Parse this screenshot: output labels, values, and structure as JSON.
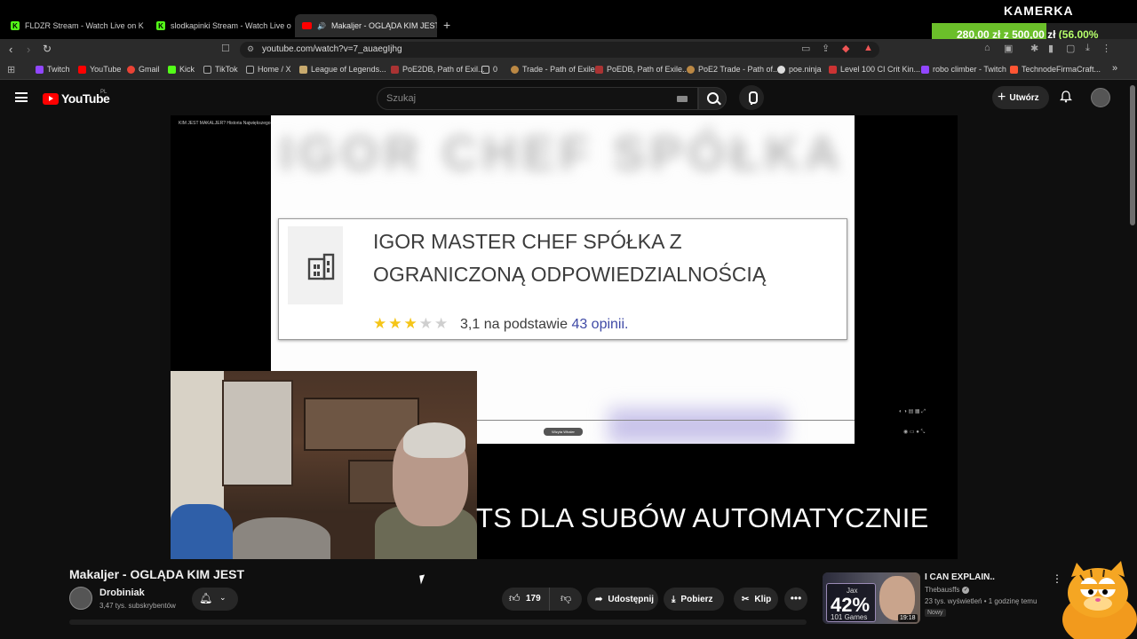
{
  "browser": {
    "tabs": [
      {
        "label": "FLDZR Stream - Watch Live on Kick",
        "favicon": "kick-icon"
      },
      {
        "label": "slodkapinki Stream - Watch Live on K",
        "favicon": "kick-icon"
      },
      {
        "label": "Makaljer - OGLĄDA KIM JEST",
        "favicon": "youtube-icon",
        "active": true
      }
    ],
    "new_tab": "+",
    "url": "youtube.com/watch?v=7_auaegIjhg",
    "bookmarks": [
      {
        "label": "Twitch",
        "color": "#9146ff"
      },
      {
        "label": "YouTube",
        "color": "#ff0000"
      },
      {
        "label": "Gmail",
        "color": "#ea4335"
      },
      {
        "label": "Kick",
        "color": "#53fc18"
      },
      {
        "label": "TikTok",
        "color": "#222222"
      },
      {
        "label": "Home / X",
        "color": "#222222"
      },
      {
        "label": "League of Legends...",
        "color": "#c8aa6e"
      },
      {
        "label": "PoE2DB, Path of Exil...",
        "color": "#a33"
      },
      {
        "label": "0",
        "color": "#777777"
      },
      {
        "label": "Trade - Path of Exile",
        "color": "#bb8844"
      },
      {
        "label": "PoEDB, Path of Exile...",
        "color": "#a33"
      },
      {
        "label": "PoE2 Trade - Path of...",
        "color": "#bb8844"
      },
      {
        "label": "poe.ninja",
        "color": "#dddddd"
      },
      {
        "label": "Level 100 CI Crit Kin...",
        "color": "#cc3333"
      },
      {
        "label": "robo climber - Twitch",
        "color": "#9146ff"
      },
      {
        "label": "TechnodeFirmaCraft...",
        "color": "#ff5533"
      }
    ],
    "bookmarks_more": "»"
  },
  "overlay": {
    "kamerka": "KAMERKA",
    "goal_current": "280,00 zł",
    "goal_sep": "z",
    "goal_target": "500,00 zł",
    "goal_pct": "(56.00%",
    "goal_fraction": 0.56
  },
  "yt": {
    "logo_text": "YouTube",
    "country": "PL",
    "search_placeholder": "Szukaj",
    "create_label": "Utwórz"
  },
  "video": {
    "tiny_title": "KIM JEST MAKALJER? Historia Największego Oszusta Kick.com",
    "company_name": "IGOR MASTER CHEF SPÓŁKA Z OGRANICZONĄ ODPOWIEDZIALNOŚCIĄ",
    "stars_filled": 3,
    "stars_total": 5,
    "rating_prefix": "3,1 na podstawie",
    "rating_count": "43 opinii.",
    "inner_label": "Wizyta Whaler",
    "overlay_text": "TS DLA SUBÓW AUTOMATYCZNIE"
  },
  "info": {
    "title": "Makaljer - OGLĄDA KIM JEST",
    "channel": "Drobiniak",
    "subscribers": "3,47 tys. subskrybentów",
    "likes": "179",
    "share_label": "Udostępnij",
    "download_label": "Pobierz",
    "clip_label": "Klip"
  },
  "recommendation": {
    "title": "I CAN EXPLAIN..",
    "channel": "Thebausffs",
    "meta": "23 tys. wyświetleń • 1 godzinę temu",
    "badge": "Nowy",
    "duration": "19:18",
    "thumb_name": "Jax",
    "thumb_pct": "42%",
    "thumb_games": "101 Games"
  }
}
